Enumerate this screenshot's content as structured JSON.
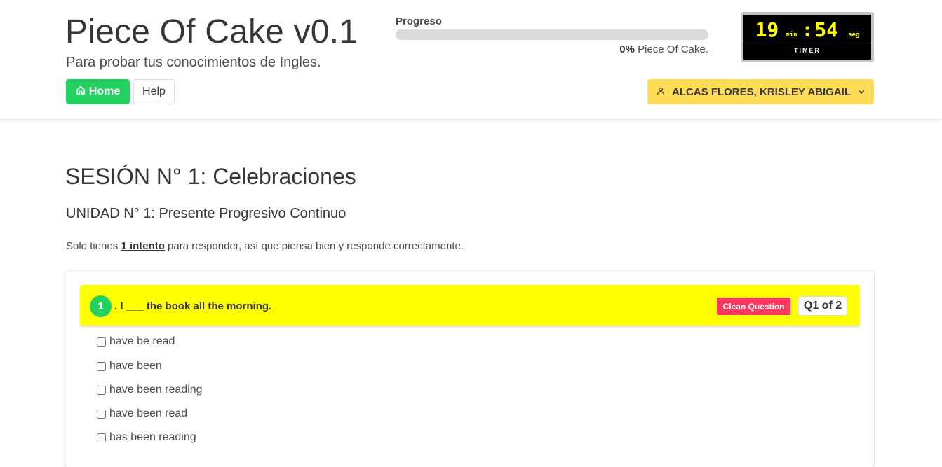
{
  "header": {
    "title": "Piece Of Cake v0.1",
    "subtitle": "Para probar tus conocimientos de Ingles.",
    "home_label": "Home",
    "help_label": "Help",
    "home_icon": "home-icon"
  },
  "progress": {
    "label": "Progreso",
    "value": 0,
    "percent_text": "0%",
    "suffix": "Piece Of Cake."
  },
  "timer": {
    "minutes": "19",
    "min_unit": "min",
    "colon": ":",
    "seconds": "54",
    "sec_unit": "seg",
    "label": "TIMER"
  },
  "user": {
    "name": "ALCAS FLORES, KRISLEY ABIGAIL",
    "icon": "user-icon",
    "dropdown_icon": "chevron-down-icon"
  },
  "session": {
    "title": "SESIÓN N° 1: Celebraciones",
    "unit": "UNIDAD N° 1: Presente Progresivo Continuo",
    "instr_before": "Solo tienes ",
    "instr_bold": "1 intento",
    "instr_after": " para responder, así que piensa bien y responde correctamente."
  },
  "question": {
    "number": "1",
    "text": ". I ___ the book all the morning.",
    "clean_label": "Clean Question",
    "counter": "Q1 of 2",
    "options": [
      "have be read",
      "have been",
      "have been reading",
      "have been read",
      "has been reading"
    ]
  },
  "colors": {
    "success": "#23d160",
    "warning": "#ffdd57",
    "danger": "#ff3860",
    "question_bg": "#ffff00",
    "timer_digits": "#ffff00"
  }
}
